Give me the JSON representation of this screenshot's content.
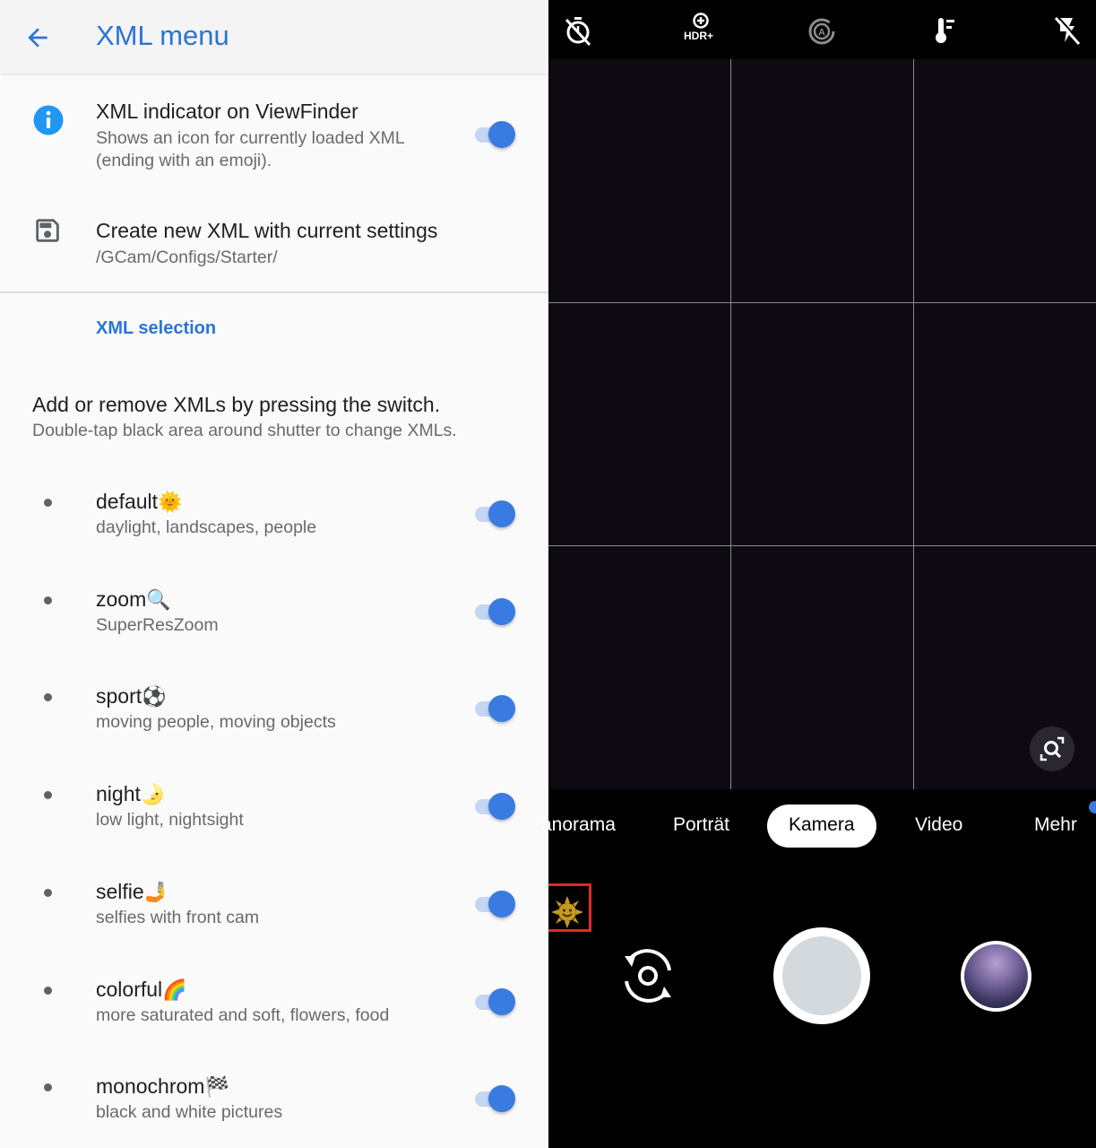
{
  "settings": {
    "appbar": {
      "title": "XML menu",
      "back_icon": "arrow-back-icon"
    },
    "indicator_row": {
      "icon": "info-icon",
      "title": "XML indicator on ViewFinder",
      "subtitle_line1": "Shows an icon for currently loaded XML",
      "subtitle_line2": "(ending with an emoji).",
      "enabled": true
    },
    "create_row": {
      "icon": "save-icon",
      "title": "Create new XML with current settings",
      "subtitle": "/GCam/Configs/Starter/"
    },
    "section_header": "XML selection",
    "help": {
      "title": "Add or remove XMLs by pressing the switch.",
      "subtitle": "Double-tap black area around shutter to change XMLs."
    },
    "xmls": [
      {
        "name": "default",
        "emoji": "🌞",
        "description": "daylight, landscapes, people",
        "enabled": true
      },
      {
        "name": "zoom",
        "emoji": "🔍",
        "description": "SuperResZoom",
        "enabled": true
      },
      {
        "name": "sport",
        "emoji": "⚽",
        "description": "moving people, moving objects",
        "enabled": true
      },
      {
        "name": "night",
        "emoji": "🌛",
        "description": "low light, nightsight",
        "enabled": true
      },
      {
        "name": "selfie",
        "emoji": "🤳",
        "description": "selfies with front cam",
        "enabled": true
      },
      {
        "name": "colorful",
        "emoji": "🌈",
        "description": "more saturated and soft, flowers, food",
        "enabled": true
      },
      {
        "name": "monochrom",
        "emoji": "🏁",
        "description": "black and white pictures",
        "enabled": true
      }
    ]
  },
  "camera": {
    "top_icons": [
      "timer-off-icon",
      "hdr-plus-icon",
      "auto-exposure-icon",
      "white-balance-icon",
      "flash-off-icon"
    ],
    "hdr_label": "HDR+",
    "modes": [
      "anorama",
      "Porträt",
      "Kamera",
      "Video",
      "Mehr"
    ],
    "active_mode": "Kamera",
    "xml_indicator_emoji": "🌞"
  },
  "colors": {
    "accent": "#2a74d6",
    "toggle_thumb": "#3a7be2",
    "toggle_track": "#c3d6f3",
    "indicator_border": "#e02a2a"
  }
}
